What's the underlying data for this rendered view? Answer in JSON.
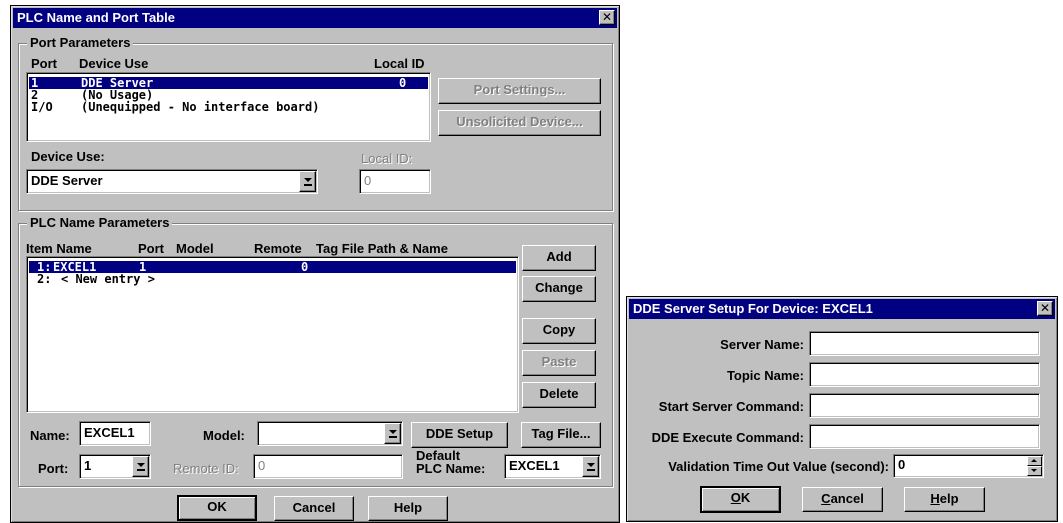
{
  "main": {
    "title": "PLC Name and Port Table",
    "close_glyph": "✕",
    "port_params": {
      "label": "Port Parameters",
      "headers": {
        "port": "Port",
        "device_use": "Device Use",
        "local_id": "Local ID"
      },
      "rows": [
        {
          "port": "1",
          "device_use": "DDE Server",
          "local_id": "0",
          "selected": true
        },
        {
          "port": "2",
          "device_use": "(No Usage)",
          "local_id": "",
          "selected": false
        },
        {
          "port": "I/O",
          "device_use": "(Unequipped - No interface board)",
          "local_id": "",
          "selected": false
        }
      ],
      "port_settings_btn": "Port Settings...",
      "unsolicited_btn": "Unsolicited Device...",
      "device_use_label": "Device Use:",
      "device_use_value": "DDE Server",
      "local_id_label": "Local ID:",
      "local_id_value": "0"
    },
    "plc_params": {
      "label": "PLC Name Parameters",
      "headers": {
        "item_name": "Item Name",
        "port": "Port",
        "model": "Model",
        "remote": "Remote",
        "tag_file": "Tag File Path & Name"
      },
      "rows": [
        {
          "idx": "1:",
          "name": "EXCEL1",
          "port": "1",
          "remote": "0",
          "selected": true
        },
        {
          "idx": "2:",
          "name": "< New entry >",
          "port": "",
          "remote": "",
          "selected": false
        }
      ],
      "add_btn": "Add",
      "change_btn": "Change",
      "copy_btn": "Copy",
      "paste_btn": "Paste",
      "delete_btn": "Delete",
      "name_label": "Name:",
      "name_value": "EXCEL1",
      "model_label": "Model:",
      "model_value": "",
      "dde_setup_btn": "DDE Setup",
      "tag_file_btn": "Tag File...",
      "port_label": "Port:",
      "port_value": "1",
      "remote_id_label": "Remote ID:",
      "remote_id_value": "0",
      "default_plc_label_1": "Default",
      "default_plc_label_2": "PLC Name:",
      "default_plc_value": "EXCEL1"
    },
    "ok_btn": "OK",
    "cancel_btn": "Cancel",
    "help_btn": "Help"
  },
  "dde": {
    "title": "DDE Server Setup For Device: EXCEL1",
    "close_glyph": "✕",
    "server_name_label": "Server Name:",
    "server_name_value": "",
    "topic_name_label": "Topic Name:",
    "topic_name_value": "",
    "start_cmd_label": "Start Server Command:",
    "start_cmd_value": "",
    "execute_cmd_label": "DDE Execute Command:",
    "execute_cmd_value": "",
    "timeout_label": "Validation Time Out Value (second):",
    "timeout_value": "0",
    "ok_first": "O",
    "ok_rest": "K",
    "cancel_first": "C",
    "cancel_rest": "ancel",
    "help_first": "H",
    "help_rest": "elp"
  }
}
